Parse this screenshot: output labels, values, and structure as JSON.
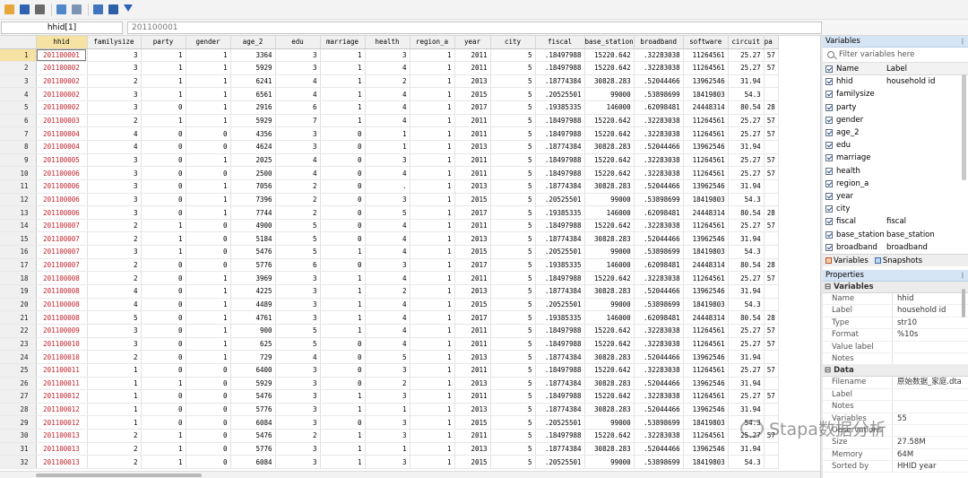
{
  "toolbar": {
    "icons": [
      "open-icon",
      "save-icon",
      "print-icon",
      "copy-icon",
      "paste-icon",
      "edit-icon",
      "browse-icon",
      "filter-icon"
    ]
  },
  "editbar": {
    "cell_name": "hhid[1]",
    "cell_value": "201100001"
  },
  "grid": {
    "columns": [
      "hhid",
      "familysize",
      "party",
      "gender",
      "age_2",
      "edu",
      "marriage",
      "health",
      "region_a",
      "year",
      "city",
      "fiscal",
      "base_station",
      "broadband",
      "software",
      "circuit",
      "pa"
    ],
    "rows": [
      [
        "1",
        "201100001",
        "3",
        "1",
        "1",
        "3364",
        "3",
        "1",
        "3",
        "1",
        "2011",
        "5",
        ".18497988",
        "15220.642",
        ".32283038",
        "11264561",
        "25.27",
        "57"
      ],
      [
        "2",
        "201100002",
        "3",
        "1",
        "1",
        "5929",
        "3",
        "1",
        "4",
        "1",
        "2011",
        "5",
        ".18497988",
        "15220.642",
        ".32283038",
        "11264561",
        "25.27",
        "57"
      ],
      [
        "3",
        "201100002",
        "2",
        "1",
        "1",
        "6241",
        "4",
        "1",
        "2",
        "1",
        "2013",
        "5",
        ".18774384",
        "30828.283",
        ".52044466",
        "13962546",
        "31.94",
        ""
      ],
      [
        "4",
        "201100002",
        "3",
        "1",
        "1",
        "6561",
        "4",
        "1",
        "4",
        "1",
        "2015",
        "5",
        ".20525501",
        "99000",
        ".53898699",
        "18419803",
        "54.3",
        ""
      ],
      [
        "5",
        "201100002",
        "3",
        "0",
        "1",
        "2916",
        "6",
        "1",
        "4",
        "1",
        "2017",
        "5",
        ".19385335",
        "146000",
        ".62098481",
        "24448314",
        "80.54",
        "28"
      ],
      [
        "6",
        "201100003",
        "2",
        "1",
        "1",
        "5929",
        "7",
        "1",
        "4",
        "1",
        "2011",
        "5",
        ".18497988",
        "15220.642",
        ".32283038",
        "11264561",
        "25.27",
        "57"
      ],
      [
        "7",
        "201100004",
        "4",
        "0",
        "0",
        "4356",
        "3",
        "0",
        "1",
        "1",
        "2011",
        "5",
        ".18497988",
        "15220.642",
        ".32283038",
        "11264561",
        "25.27",
        "57"
      ],
      [
        "8",
        "201100004",
        "4",
        "0",
        "0",
        "4624",
        "3",
        "0",
        "1",
        "1",
        "2013",
        "5",
        ".18774384",
        "30828.283",
        ".52044466",
        "13962546",
        "31.94",
        ""
      ],
      [
        "9",
        "201100005",
        "3",
        "0",
        "1",
        "2025",
        "4",
        "0",
        "3",
        "1",
        "2011",
        "5",
        ".18497988",
        "15220.642",
        ".32283038",
        "11264561",
        "25.27",
        "57"
      ],
      [
        "10",
        "201100006",
        "3",
        "0",
        "0",
        "2500",
        "4",
        "0",
        "4",
        "1",
        "2011",
        "5",
        ".18497988",
        "15220.642",
        ".32283038",
        "11264561",
        "25.27",
        "57"
      ],
      [
        "11",
        "201100006",
        "3",
        "0",
        "1",
        "7056",
        "2",
        "0",
        ".",
        "1",
        "2013",
        "5",
        ".18774384",
        "30828.283",
        ".52044466",
        "13962546",
        "31.94",
        ""
      ],
      [
        "12",
        "201100006",
        "3",
        "0",
        "1",
        "7396",
        "2",
        "0",
        "3",
        "1",
        "2015",
        "5",
        ".20525501",
        "99000",
        ".53898699",
        "18419803",
        "54.3",
        ""
      ],
      [
        "13",
        "201100006",
        "3",
        "0",
        "1",
        "7744",
        "2",
        "0",
        "5",
        "1",
        "2017",
        "5",
        ".19385335",
        "146000",
        ".62098481",
        "24448314",
        "80.54",
        "28"
      ],
      [
        "14",
        "201100007",
        "2",
        "1",
        "0",
        "4900",
        "5",
        "0",
        "4",
        "1",
        "2011",
        "5",
        ".18497988",
        "15220.642",
        ".32283038",
        "11264561",
        "25.27",
        "57"
      ],
      [
        "15",
        "201100007",
        "2",
        "1",
        "0",
        "5184",
        "5",
        "0",
        "4",
        "1",
        "2013",
        "5",
        ".18774384",
        "30828.283",
        ".52044466",
        "13962546",
        "31.94",
        ""
      ],
      [
        "16",
        "201100007",
        "3",
        "1",
        "0",
        "5476",
        "5",
        "1",
        "4",
        "1",
        "2015",
        "5",
        ".20525501",
        "99000",
        ".53898699",
        "18419803",
        "54.3",
        ""
      ],
      [
        "17",
        "201100007",
        "2",
        "0",
        "0",
        "5776",
        "6",
        "0",
        "3",
        "1",
        "2017",
        "5",
        ".19385335",
        "146000",
        ".62098481",
        "24448314",
        "80.54",
        "28"
      ],
      [
        "18",
        "201100008",
        "2",
        "0",
        "1",
        "3969",
        "3",
        "1",
        "4",
        "1",
        "2011",
        "5",
        ".18497988",
        "15220.642",
        ".32283038",
        "11264561",
        "25.27",
        "57"
      ],
      [
        "19",
        "201100008",
        "4",
        "0",
        "1",
        "4225",
        "3",
        "1",
        "2",
        "1",
        "2013",
        "5",
        ".18774384",
        "30828.283",
        ".52044466",
        "13962546",
        "31.94",
        ""
      ],
      [
        "20",
        "201100008",
        "4",
        "0",
        "1",
        "4489",
        "3",
        "1",
        "4",
        "1",
        "2015",
        "5",
        ".20525501",
        "99000",
        ".53898699",
        "18419803",
        "54.3",
        ""
      ],
      [
        "21",
        "201100008",
        "5",
        "0",
        "1",
        "4761",
        "3",
        "1",
        "4",
        "1",
        "2017",
        "5",
        ".19385335",
        "146000",
        ".62098481",
        "24448314",
        "80.54",
        "28"
      ],
      [
        "22",
        "201100009",
        "3",
        "0",
        "1",
        "900",
        "5",
        "1",
        "4",
        "1",
        "2011",
        "5",
        ".18497988",
        "15220.642",
        ".32283038",
        "11264561",
        "25.27",
        "57"
      ],
      [
        "23",
        "201100010",
        "3",
        "0",
        "1",
        "625",
        "5",
        "0",
        "4",
        "1",
        "2011",
        "5",
        ".18497988",
        "15220.642",
        ".32283038",
        "11264561",
        "25.27",
        "57"
      ],
      [
        "24",
        "201100010",
        "2",
        "0",
        "1",
        "729",
        "4",
        "0",
        "5",
        "1",
        "2013",
        "5",
        ".18774384",
        "30828.283",
        ".52044466",
        "13962546",
        "31.94",
        ""
      ],
      [
        "25",
        "201100011",
        "1",
        "0",
        "0",
        "6400",
        "3",
        "0",
        "3",
        "1",
        "2011",
        "5",
        ".18497988",
        "15220.642",
        ".32283038",
        "11264561",
        "25.27",
        "57"
      ],
      [
        "26",
        "201100011",
        "1",
        "1",
        "0",
        "5929",
        "3",
        "0",
        "2",
        "1",
        "2013",
        "5",
        ".18774384",
        "30828.283",
        ".52044466",
        "13962546",
        "31.94",
        ""
      ],
      [
        "27",
        "201100012",
        "1",
        "0",
        "0",
        "5476",
        "3",
        "1",
        "3",
        "1",
        "2011",
        "5",
        ".18497988",
        "15220.642",
        ".32283038",
        "11264561",
        "25.27",
        "57"
      ],
      [
        "28",
        "201100012",
        "1",
        "0",
        "0",
        "5776",
        "3",
        "1",
        "1",
        "1",
        "2013",
        "5",
        ".18774384",
        "30828.283",
        ".52044466",
        "13962546",
        "31.94",
        ""
      ],
      [
        "29",
        "201100012",
        "1",
        "0",
        "0",
        "6084",
        "3",
        "0",
        "3",
        "1",
        "2015",
        "5",
        ".20525501",
        "99000",
        ".53898699",
        "18419803",
        "54.3",
        ""
      ],
      [
        "30",
        "201100013",
        "2",
        "1",
        "0",
        "5476",
        "2",
        "1",
        "3",
        "1",
        "2011",
        "5",
        ".18497988",
        "15220.642",
        ".32283038",
        "11264561",
        "25.27",
        "57"
      ],
      [
        "31",
        "201100013",
        "2",
        "1",
        "0",
        "5776",
        "3",
        "1",
        "1",
        "1",
        "2013",
        "5",
        ".18774384",
        "30828.283",
        ".52044466",
        "13962546",
        "31.94",
        ""
      ],
      [
        "32",
        "201100013",
        "2",
        "1",
        "0",
        "6084",
        "3",
        "1",
        "3",
        "1",
        "2015",
        "5",
        ".20525501",
        "99000",
        ".53898699",
        "18419803",
        "54.3",
        ""
      ]
    ]
  },
  "variables_panel": {
    "title": "Variables",
    "filter_placeholder": "Filter variables here",
    "col_name": "Name",
    "col_label": "Label",
    "items": [
      {
        "name": "hhid",
        "label": "household id"
      },
      {
        "name": "familysize",
        "label": ""
      },
      {
        "name": "party",
        "label": ""
      },
      {
        "name": "gender",
        "label": ""
      },
      {
        "name": "age_2",
        "label": ""
      },
      {
        "name": "edu",
        "label": ""
      },
      {
        "name": "marriage",
        "label": ""
      },
      {
        "name": "health",
        "label": ""
      },
      {
        "name": "region_a",
        "label": ""
      },
      {
        "name": "year",
        "label": ""
      },
      {
        "name": "city",
        "label": ""
      },
      {
        "name": "fiscal",
        "label": "fiscal"
      },
      {
        "name": "base_station",
        "label": "base_station"
      },
      {
        "name": "broadband",
        "label": "broadband"
      }
    ],
    "tab_variables": "Variables",
    "tab_snapshots": "Snapshots"
  },
  "properties_panel": {
    "title": "Properties",
    "variables_section": "Variables",
    "variables": [
      {
        "key": "Name",
        "value": "hhid"
      },
      {
        "key": "Label",
        "value": "household id"
      },
      {
        "key": "Type",
        "value": "str10"
      },
      {
        "key": "Format",
        "value": "%10s"
      },
      {
        "key": "Value label",
        "value": ""
      },
      {
        "key": "Notes",
        "value": ""
      }
    ],
    "data_section": "Data",
    "data": [
      {
        "key": "Filename",
        "value": "原始数据_家庭.dta"
      },
      {
        "key": "Label",
        "value": ""
      },
      {
        "key": "Notes",
        "value": ""
      },
      {
        "key": "Variables",
        "value": "55"
      },
      {
        "key": "Observations",
        "value": ""
      },
      {
        "key": "Size",
        "value": "27.58M"
      },
      {
        "key": "Memory",
        "value": "64M"
      },
      {
        "key": "Sorted by",
        "value": "HHID year"
      }
    ]
  },
  "watermark": "Stata and 数据分析"
}
